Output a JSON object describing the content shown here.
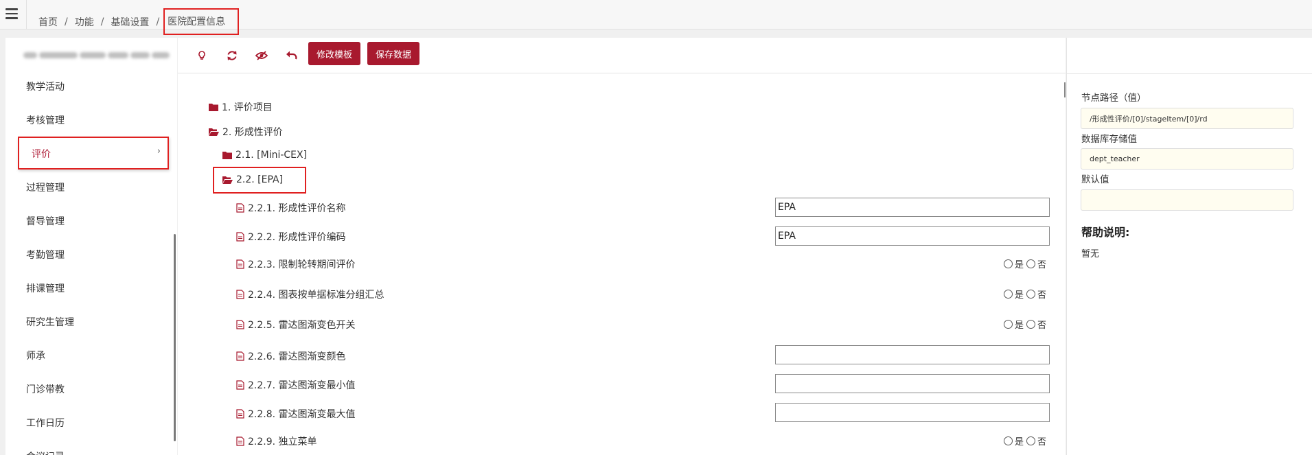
{
  "breadcrumb": {
    "items": [
      "首页",
      "功能",
      "基础设置"
    ],
    "current": "医院配置信息",
    "separator": "/"
  },
  "sidebar": {
    "items": [
      {
        "label": "教学活动"
      },
      {
        "label": "考核管理"
      },
      {
        "label": "评价",
        "active": true
      },
      {
        "label": "过程管理"
      },
      {
        "label": "督导管理"
      },
      {
        "label": "考勤管理"
      },
      {
        "label": "排课管理"
      },
      {
        "label": "研究生管理"
      },
      {
        "label": "师承"
      },
      {
        "label": "门诊带教"
      },
      {
        "label": "工作日历"
      },
      {
        "label": "会议记录"
      }
    ]
  },
  "toolbar": {
    "icons": [
      "lightbulb-icon",
      "refresh-icon",
      "eye-slash-icon",
      "undo-icon"
    ],
    "modify_label": "修改模板",
    "save_label": "保存数据"
  },
  "tree": {
    "n1": "1. 评价项目",
    "n2": "2. 形成性评价",
    "n21": "2.1. [Mini-CEX]",
    "n22": "2.2. [EPA]",
    "leaves": [
      {
        "label": "2.2.1. 形成性评价名称",
        "type": "text",
        "value": "EPA"
      },
      {
        "label": "2.2.2. 形成性评价编码",
        "type": "text",
        "value": "EPA"
      },
      {
        "label": "2.2.3. 限制轮转期间评价",
        "type": "radio"
      },
      {
        "label": "2.2.4. 图表按单据标准分组汇总",
        "type": "radio"
      },
      {
        "label": "2.2.5. 雷达图渐变色开关",
        "type": "radio"
      },
      {
        "label": "2.2.6. 雷达图渐变颜色",
        "type": "text",
        "value": ""
      },
      {
        "label": "2.2.7. 雷达图渐变最小值",
        "type": "text",
        "value": ""
      },
      {
        "label": "2.2.8. 雷达图渐变最大值",
        "type": "text",
        "value": ""
      },
      {
        "label": "2.2.9. 独立菜单",
        "type": "radio"
      }
    ],
    "yes": "是",
    "no": "否"
  },
  "right_panel": {
    "path_label": "节点路径（值）",
    "path_value": "/形成性评价/[0]/stageItem/[0]/rd",
    "db_label": "数据库存储值",
    "db_value": "dept_teacher",
    "default_label": "默认值",
    "default_value": "",
    "help_title": "帮助说明:",
    "help_value": "暂无"
  },
  "colors": {
    "accent": "#a8192e",
    "highlight_border": "#e02020",
    "input_bg": "#fffdf0"
  }
}
